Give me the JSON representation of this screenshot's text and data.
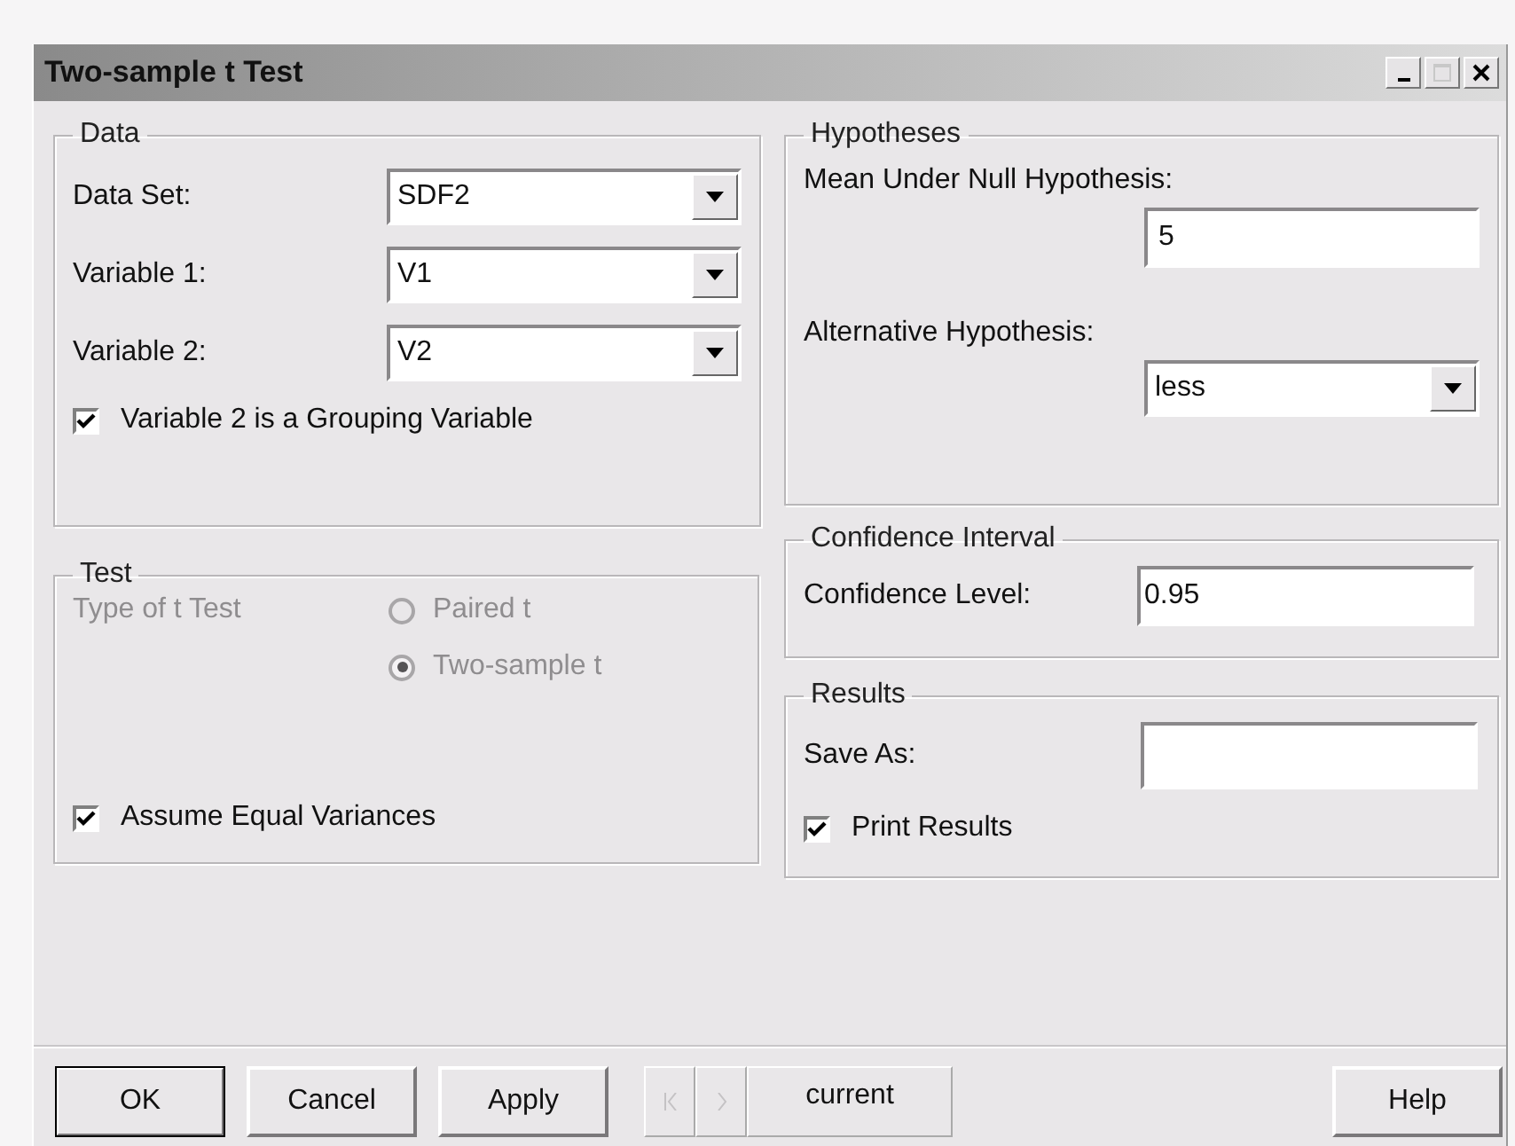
{
  "window": {
    "title": "Two-sample t Test",
    "controls": [
      {
        "kind": "minimize",
        "disabled": false
      },
      {
        "kind": "maximize",
        "disabled": true
      },
      {
        "kind": "close",
        "disabled": false
      }
    ]
  },
  "data": {
    "title": "Data",
    "fields": [
      {
        "label": "Data Set:",
        "value": "SDF2"
      },
      {
        "label": "Variable 1:",
        "value": "V1"
      },
      {
        "label": "Variable 2:",
        "value": "V2"
      }
    ],
    "grouping": {
      "label": "Variable 2 is a Grouping Variable",
      "checked": true
    }
  },
  "test": {
    "title": "Test",
    "disabled": true,
    "type_label": "Type of t Test",
    "radios": [
      {
        "label": "Paired t",
        "selected": false
      },
      {
        "label": "Two-sample t",
        "selected": true
      }
    ],
    "equal_variances": {
      "label": "Assume Equal Variances",
      "checked": true
    }
  },
  "hypotheses": {
    "title": "Hypotheses",
    "null_label": "Mean Under Null Hypothesis:",
    "null_value": "5",
    "alt_label": "Alternative Hypothesis:",
    "alt_value": "less"
  },
  "confidence": {
    "title": "Confidence Interval",
    "label": "Confidence Level:",
    "value": "0.95"
  },
  "results": {
    "title": "Results",
    "save_label": "Save As:",
    "print": {
      "label": "Print Results",
      "checked": true
    }
  },
  "buttons": [
    {
      "label": "OK",
      "default": true
    },
    {
      "label": "Cancel",
      "default": false
    },
    {
      "label": "Apply",
      "default": false
    }
  ],
  "nav": [
    {
      "kind": "previous",
      "disabled": true
    },
    {
      "kind": "next",
      "disabled": true
    }
  ],
  "current": "current",
  "help": "Help"
}
